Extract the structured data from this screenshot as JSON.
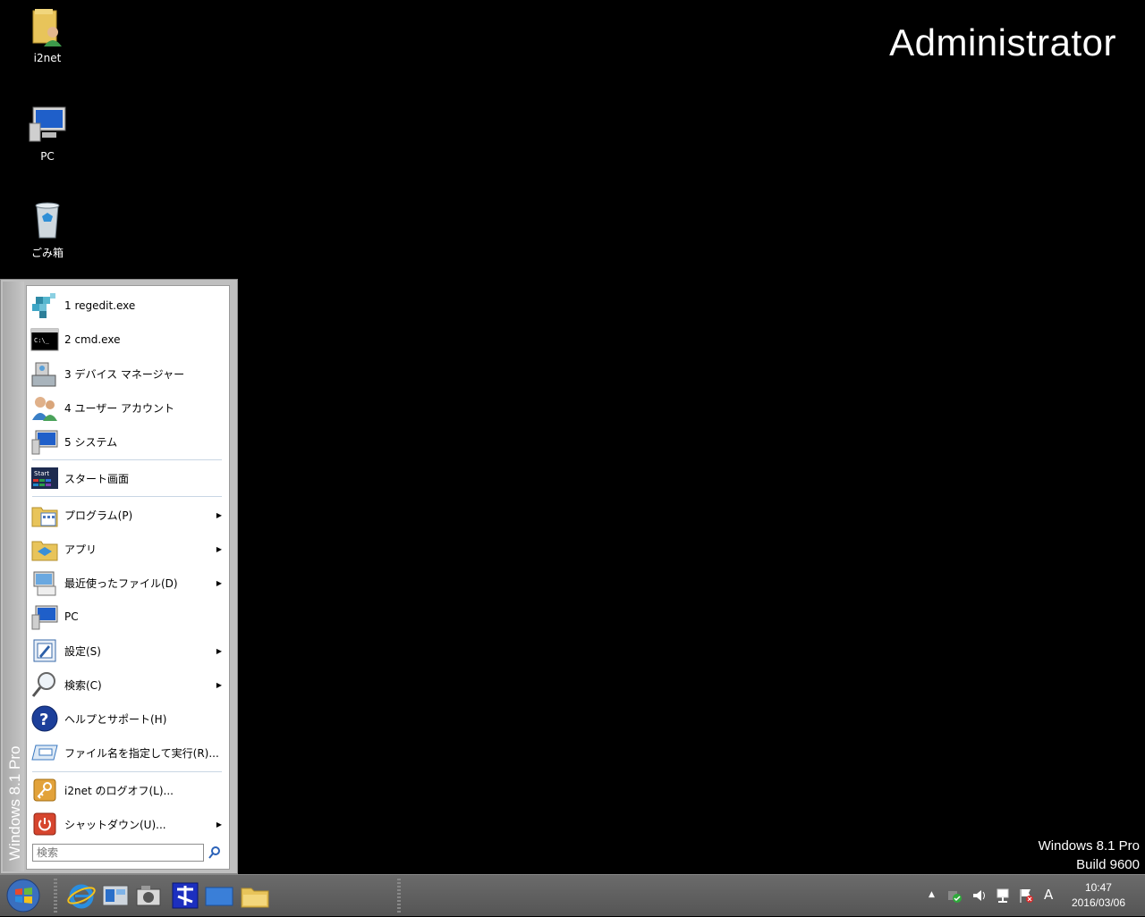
{
  "desktop": {
    "icons": [
      {
        "label": "i2net",
        "icon": "user-folder-icon"
      },
      {
        "label": "PC",
        "icon": "computer-icon"
      },
      {
        "label": "ごみ箱",
        "icon": "recycle-bin-icon"
      }
    ],
    "banner": "Administrator",
    "version_line1": "Windows 8.1 Pro",
    "version_line2": "Build 9600"
  },
  "start_menu": {
    "strip_title": "Windows 8.1 Pro",
    "recent": [
      {
        "label": "1 regedit.exe",
        "icon": "regedit-icon"
      },
      {
        "label": "2 cmd.exe",
        "icon": "cmd-icon"
      },
      {
        "label": "3 デバイス マネージャー",
        "icon": "device-manager-icon"
      },
      {
        "label": "4 ユーザー アカウント",
        "icon": "user-accounts-icon"
      },
      {
        "label": "5 システム",
        "icon": "system-icon"
      }
    ],
    "start_screen": {
      "label": "スタート画面",
      "badge": "Start"
    },
    "items": [
      {
        "label": "プログラム(P)",
        "icon": "programs-folder-icon",
        "submenu": true
      },
      {
        "label": "アプリ",
        "icon": "apps-folder-icon",
        "submenu": true
      },
      {
        "label": "最近使ったファイル(D)",
        "icon": "recent-files-icon",
        "submenu": true
      },
      {
        "label": "PC",
        "icon": "pc-icon",
        "submenu": false
      },
      {
        "label": "設定(S)",
        "icon": "settings-icon",
        "submenu": true
      },
      {
        "label": "検索(C)",
        "icon": "search-magnifier-icon",
        "submenu": true
      },
      {
        "label": "ヘルプとサポート(H)",
        "icon": "help-icon",
        "submenu": false
      },
      {
        "label": "ファイル名を指定して実行(R)...",
        "icon": "run-icon",
        "submenu": false
      }
    ],
    "logoff": {
      "label": "i2net のログオフ(L)...",
      "icon": "key-icon"
    },
    "shutdown": {
      "label": "シャットダウン(U)...",
      "icon": "power-icon"
    },
    "search_placeholder": "検索"
  },
  "taskbar": {
    "clock_time": "10:47",
    "clock_date": "2016/03/06",
    "ime": "A"
  },
  "colors": {
    "taskbar": "#5e5e5e",
    "menu_bg": "#ffffff",
    "accent_blue": "#1c5fb8"
  }
}
